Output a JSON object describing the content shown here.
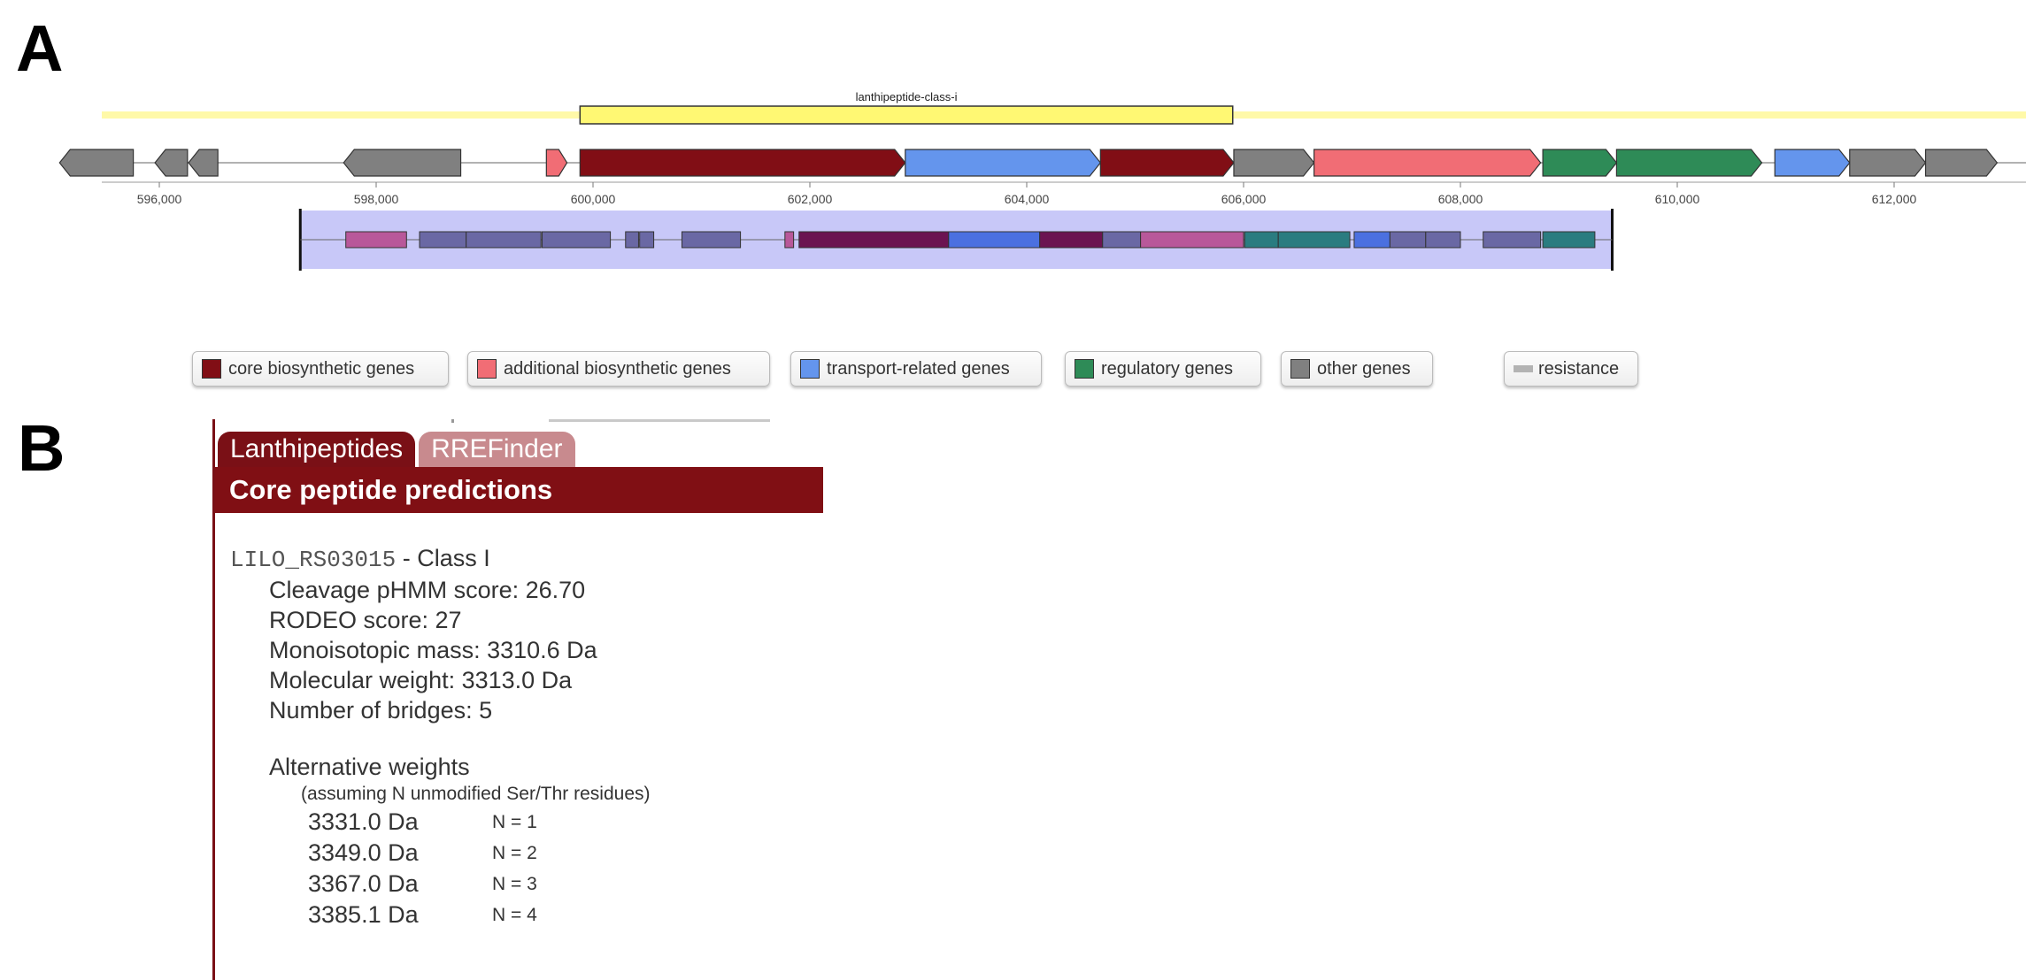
{
  "panel_labels": {
    "a": "A",
    "b": "B"
  },
  "region": {
    "label": "lanthipeptide-class-i",
    "start": 599880,
    "end": 605900,
    "color": "#fff873"
  },
  "axis": {
    "ticks": [
      596000,
      598000,
      600000,
      602000,
      604000,
      606000,
      608000,
      610000,
      612000
    ],
    "tick_labels": [
      "596,000",
      "598,000",
      "600,000",
      "602,000",
      "604,000",
      "606,000",
      "608,000",
      "610,000",
      "612,000"
    ]
  },
  "colors": {
    "core": "#810e15",
    "additional": "#f16d75",
    "transport": "#6495ed",
    "regulatory": "#2e8b57",
    "other": "#808080",
    "resistance": "#b3b3b3",
    "domain_backdrop": "#c8c8f8"
  },
  "genes": [
    {
      "start": 595080,
      "end": 595760,
      "strand": -1,
      "type": "other"
    },
    {
      "start": 595960,
      "end": 596260,
      "strand": -1,
      "type": "other"
    },
    {
      "start": 596270,
      "end": 596540,
      "strand": -1,
      "type": "other"
    },
    {
      "start": 597700,
      "end": 598780,
      "strand": -1,
      "type": "other"
    },
    {
      "start": 599570,
      "end": 599760,
      "strand": 1,
      "type": "additional"
    },
    {
      "start": 599880,
      "end": 602880,
      "strand": 1,
      "type": "core"
    },
    {
      "start": 602880,
      "end": 604680,
      "strand": 1,
      "type": "transport"
    },
    {
      "start": 604680,
      "end": 605910,
      "strand": 1,
      "type": "core"
    },
    {
      "start": 605910,
      "end": 606650,
      "strand": 1,
      "type": "other"
    },
    {
      "start": 606650,
      "end": 608740,
      "strand": 1,
      "type": "additional"
    },
    {
      "start": 608760,
      "end": 609440,
      "strand": 1,
      "type": "regulatory"
    },
    {
      "start": 609440,
      "end": 610780,
      "strand": 1,
      "type": "regulatory"
    },
    {
      "start": 610900,
      "end": 611590,
      "strand": 1,
      "type": "transport"
    },
    {
      "start": 611590,
      "end": 612290,
      "strand": 1,
      "type": "other"
    },
    {
      "start": 612290,
      "end": 612950,
      "strand": 1,
      "type": "other"
    }
  ],
  "domain_track": {
    "start": 597300,
    "end": 609400,
    "domains": [
      {
        "start": 597720,
        "end": 598280,
        "color": "#b8589a"
      },
      {
        "start": 598400,
        "end": 598830,
        "color": "#6a68a4"
      },
      {
        "start": 598830,
        "end": 599520,
        "color": "#6a68a4"
      },
      {
        "start": 599530,
        "end": 600160,
        "color": "#6a68a4"
      },
      {
        "start": 600300,
        "end": 600420,
        "color": "#6a68a4"
      },
      {
        "start": 600430,
        "end": 600560,
        "color": "#6a68a4"
      },
      {
        "start": 600820,
        "end": 601360,
        "color": "#6a68a4"
      },
      {
        "start": 601770,
        "end": 601850,
        "color": "#b8589a"
      },
      {
        "start": 601900,
        "end": 603280,
        "color": "#6b1451"
      },
      {
        "start": 603280,
        "end": 604120,
        "color": "#4b70e0"
      },
      {
        "start": 604120,
        "end": 604700,
        "color": "#6b1451"
      },
      {
        "start": 604700,
        "end": 605050,
        "color": "#6a68a4"
      },
      {
        "start": 605050,
        "end": 606000,
        "color": "#b8589a"
      },
      {
        "start": 606010,
        "end": 606320,
        "color": "#2a7c80"
      },
      {
        "start": 606320,
        "end": 606980,
        "color": "#2a7c80"
      },
      {
        "start": 607020,
        "end": 607350,
        "color": "#4b70e0"
      },
      {
        "start": 607350,
        "end": 607680,
        "color": "#6a68a4"
      },
      {
        "start": 607680,
        "end": 608000,
        "color": "#6a68a4"
      },
      {
        "start": 608210,
        "end": 608740,
        "color": "#6a68a4"
      },
      {
        "start": 608760,
        "end": 609240,
        "color": "#2a7c80"
      }
    ]
  },
  "legend": [
    {
      "key": "core",
      "label": "core biosynthetic genes"
    },
    {
      "key": "additional",
      "label": "additional biosynthetic genes"
    },
    {
      "key": "transport",
      "label": "transport-related genes"
    },
    {
      "key": "regulatory",
      "label": "regulatory genes"
    },
    {
      "key": "other",
      "label": "other genes"
    },
    {
      "key": "resistance",
      "label": "resistance"
    }
  ],
  "tabs": [
    {
      "label": "Lanthipeptides",
      "active": true
    },
    {
      "label": "RREFinder",
      "active": false
    }
  ],
  "header": "Core peptide predictions",
  "prediction": {
    "locus": "LILO_RS03015",
    "class_text": "- Class I",
    "lines": [
      "Cleavage pHMM score: 26.70",
      "RODEO score: 27",
      "Monoisotopic mass: 3310.6 Da",
      "Molecular weight: 3313.0 Da",
      "Number of bridges: 5"
    ],
    "alt_title": "Alternative weights",
    "alt_note": "(assuming N unmodified Ser/Thr residues)",
    "alt_weights": [
      {
        "mass": "3331.0 Da",
        "n": "N = 1"
      },
      {
        "mass": "3349.0 Da",
        "n": "N = 2"
      },
      {
        "mass": "3367.0 Da",
        "n": "N = 3"
      },
      {
        "mass": "3385.1 Da",
        "n": "N = 4"
      }
    ]
  }
}
